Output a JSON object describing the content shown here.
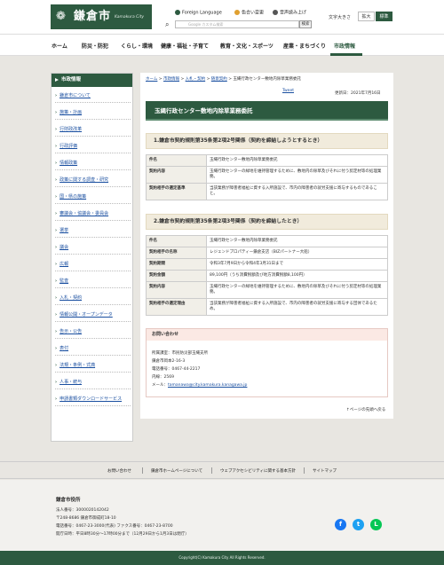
{
  "header": {
    "logo_text": "鎌倉市",
    "logo_en": "Kamakura City",
    "foreign_language": "Foreign Language",
    "color_change": "色合い変更",
    "read_aloud": "音声読み上げ",
    "search_placeholder": "Google カスタム検索",
    "search_button": "検索",
    "font_size_label": "文字大きさ",
    "font_large": "拡大",
    "font_standard": "標準"
  },
  "nav": [
    "ホーム",
    "防災・防犯",
    "くらし・環境",
    "健康・福祉・子育て",
    "教育・文化・スポーツ",
    "産業・まちづくり",
    "市政情報"
  ],
  "sidebar": {
    "title": "市政情報",
    "items": [
      "鎌倉市について",
      "施策・計画",
      "行財政改革",
      "行政評価",
      "情報政策",
      "政策に関する調査・研究",
      "国・県の施策",
      "審議会・協議会・委員会",
      "選挙",
      "議会",
      "広報",
      "監査",
      "入札・契約",
      "情報公開・オープンデータ",
      "告示・公告",
      "表付",
      "法規・条例・式典",
      "人事・統与",
      "申請書類ダウンロードサービス"
    ]
  },
  "breadcrumb": [
    "ホーム",
    "市政情報",
    "入札・契約",
    "随意契約",
    "玉縄行政センター敷地内除草業務委託"
  ],
  "tweet": "Tweet",
  "updated": "更新日：2021年7月16日",
  "page_title": "玉縄行政センター敷地内除草業務委託",
  "section1": {
    "heading": "1.鎌倉市契約規則第35条第2項2号関係（契約を締結しようとするとき）",
    "rows": [
      {
        "k": "件名",
        "v": "玉縄行政センター敷地内除草業務委託"
      },
      {
        "k": "契約内容",
        "v": "玉縄行政センターの緑地を維持管理するために、敷地内の除草及びそれに付う剪定材等の処理業務。"
      },
      {
        "k": "契約相手の選定基準",
        "v": "当該業務が障害者福祉に資する入所施設で、市内の障害者の就労支援に寄与するものであること。"
      }
    ]
  },
  "section2": {
    "heading": "2.鎌倉市契約規則第35条第2項3号関係（契約を締結したとき）",
    "rows": [
      {
        "k": "件名",
        "v": "玉縄行政センター敷地内除草業務委託"
      },
      {
        "k": "契約相手の名称",
        "v": "レジェンドプロパティー鎌倉支店（BIZパートナー大船）"
      },
      {
        "k": "契約期間",
        "v": "令和3年7月9日から令和4年3月31日まで"
      },
      {
        "k": "契約金額",
        "v": "89,100円（うち消費税額及び地方消費税額8,100円）"
      },
      {
        "k": "契約内容",
        "v": "玉縄行政センターの緑地を維持管理するために、敷地内の除草及びそれに付う剪定材等の処理業務。"
      },
      {
        "k": "契約相手の選定理由",
        "v": "当該業務が障害者福祉に資する入所施設で、市内の障害者の就労支援に寄与する団体であるため。"
      }
    ]
  },
  "contact": {
    "heading": "お問い合わせ",
    "lines": [
      "所属課室：市民防災部玉縄支所",
      "鎌倉市岡本2-16-3",
      "電話番号：0467-44-2217",
      "内線：2569"
    ],
    "email_label": "メール：",
    "email": "tamanawa@city.kamakura.kanagawa.jp"
  },
  "to_top": "ページの先頭へ戻る",
  "footer_links": [
    "お問い合わせ",
    "鎌倉市ホームページについて",
    "ウェブアクセシビリティに関する基本方針",
    "サイトマップ"
  ],
  "footer": {
    "name": "鎌倉市役所",
    "lines": [
      "法人番号：3000020142042",
      "〒248-8686 鎌倉市御成町18-10",
      "電話番号：0467-23-3000(代表) ファクス番号：0467-23-8700",
      "開庁日時：平日8時30分～17時00分まで（12月29日から1月3日は閉庁）"
    ],
    "copyright": "Copyright(C) Kamakura City All Rights Reserved."
  },
  "social": [
    {
      "name": "facebook-icon",
      "glyph": "f",
      "color": "#1877f2"
    },
    {
      "name": "twitter-icon",
      "glyph": "t",
      "color": "#1da1f2"
    },
    {
      "name": "line-icon",
      "glyph": "L",
      "color": "#06c755"
    }
  ]
}
